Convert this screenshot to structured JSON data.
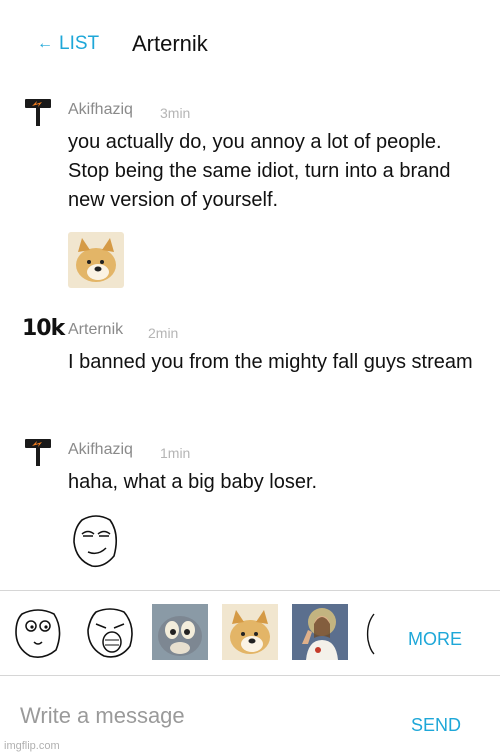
{
  "header": {
    "back_label": "LIST",
    "back_icon": "left-arrow-icon",
    "title": "Arternik"
  },
  "messages": [
    {
      "author": "Akifhaziq",
      "time": "3min",
      "avatar": "signpost-icon",
      "text": "you actually do, you annoy a lot of people. Stop being the same idiot, turn into a brand new version of yourself.",
      "sticker": "doge-sticker"
    },
    {
      "author": "Arternik",
      "time": "2min",
      "avatar": "10k",
      "text": "I banned you from the mighty fall guys stream"
    },
    {
      "author": "Akifhaziq",
      "time": "1min",
      "avatar": "signpost-icon",
      "text": "haha, what a big baby loser.",
      "sticker": "smug-rage-face-sticker"
    }
  ],
  "sticker_tray": {
    "items": [
      "derp-face",
      "lol-face",
      "tom-cat",
      "doge",
      "buddy-christ",
      "partial-sticker"
    ],
    "more_label": "MORE"
  },
  "composer": {
    "placeholder": "Write a message",
    "send_label": "SEND"
  },
  "watermark": "imgflip.com",
  "colors": {
    "accent": "#1ea7d8",
    "text": "#111111",
    "muted": "#8a8a8a",
    "avatar_orange": "#f27d1e"
  }
}
